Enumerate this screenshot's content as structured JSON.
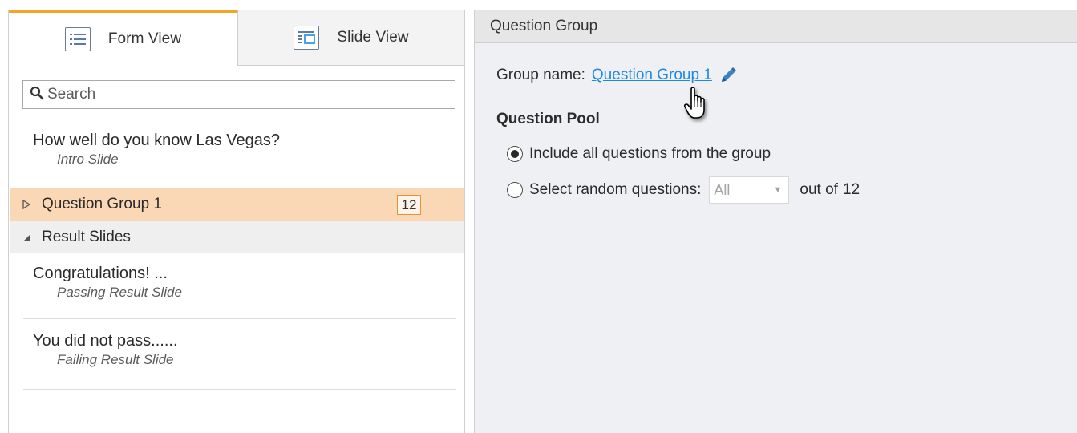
{
  "tabs": [
    {
      "label": "Form View",
      "icon": "form-list-icon",
      "active": true
    },
    {
      "label": "Slide View",
      "icon": "slide-layout-icon",
      "active": false
    }
  ],
  "search": {
    "placeholder": "Search",
    "value": ""
  },
  "list": {
    "intro": {
      "title": "How well do you know Las Vegas?",
      "subtitle": "Intro Slide"
    },
    "group": {
      "label": "Question Group 1",
      "count": "12"
    },
    "results_section": {
      "label": "Result Slides"
    },
    "results": [
      {
        "title": "Congratulations! ...",
        "subtitle": "Passing Result Slide"
      },
      {
        "title": "You did not pass......",
        "subtitle": "Failing Result Slide"
      }
    ]
  },
  "panel": {
    "header": "Question Group",
    "group_name_label": "Group name:",
    "group_name_value": "Question Group 1",
    "pool_title": "Question Pool",
    "option_all": "Include all questions from the group",
    "option_random": "Select random questions:",
    "random_select_value": "All",
    "out_of_label": "out of",
    "out_of_total": "12",
    "selected_option": "all"
  },
  "colors": {
    "active_tab_accent": "#f4a623",
    "group_row_bg": "#fbd8b5",
    "link": "#1e88e5",
    "badge_border": "#e8903a"
  }
}
